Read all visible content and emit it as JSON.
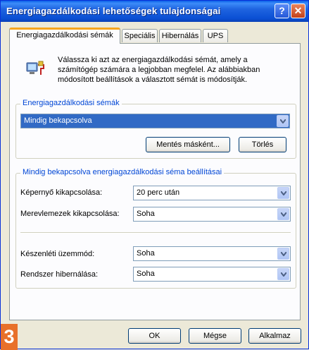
{
  "window": {
    "title": "Energiagazdálkodási lehetőségek tulajdonságai"
  },
  "tabs": [
    {
      "label": "Energiagazdálkodási sémák",
      "active": true
    },
    {
      "label": "Speciális",
      "active": false
    },
    {
      "label": "Hibernálás",
      "active": false
    },
    {
      "label": "UPS",
      "active": false
    }
  ],
  "intro": {
    "text": "Válassza ki azt az energiagazdálkodási sémát, amely a számítógép számára a legjobban megfelel. Az alábbiakban módosított beállítások a választott sémát is módosítják."
  },
  "schemes": {
    "group_title": "Energiagazdálkodási sémák",
    "selected": "Mindig bekapcsolva",
    "save_as_label": "Mentés másként...",
    "delete_label": "Törlés"
  },
  "settings": {
    "group_title": "Mindig bekapcsolva energiagazdálkodási séma beállításai",
    "rows": [
      {
        "label": "Képernyő kikapcsolása:",
        "value": "20 perc után"
      },
      {
        "label": "Merevlemezek kikapcsolása:",
        "value": "Soha"
      },
      {
        "label": "Készenléti üzemmód:",
        "value": "Soha"
      },
      {
        "label": "Rendszer hibernálása:",
        "value": "Soha"
      }
    ]
  },
  "footer": {
    "ok_label": "OK",
    "cancel_label": "Mégse",
    "apply_label": "Alkalmaz"
  },
  "badge": {
    "text": "3",
    "color": "#e8702a"
  },
  "colors": {
    "titlebar": "#0a4fd3",
    "accent": "#0046d5",
    "selection": "#316ac5"
  }
}
